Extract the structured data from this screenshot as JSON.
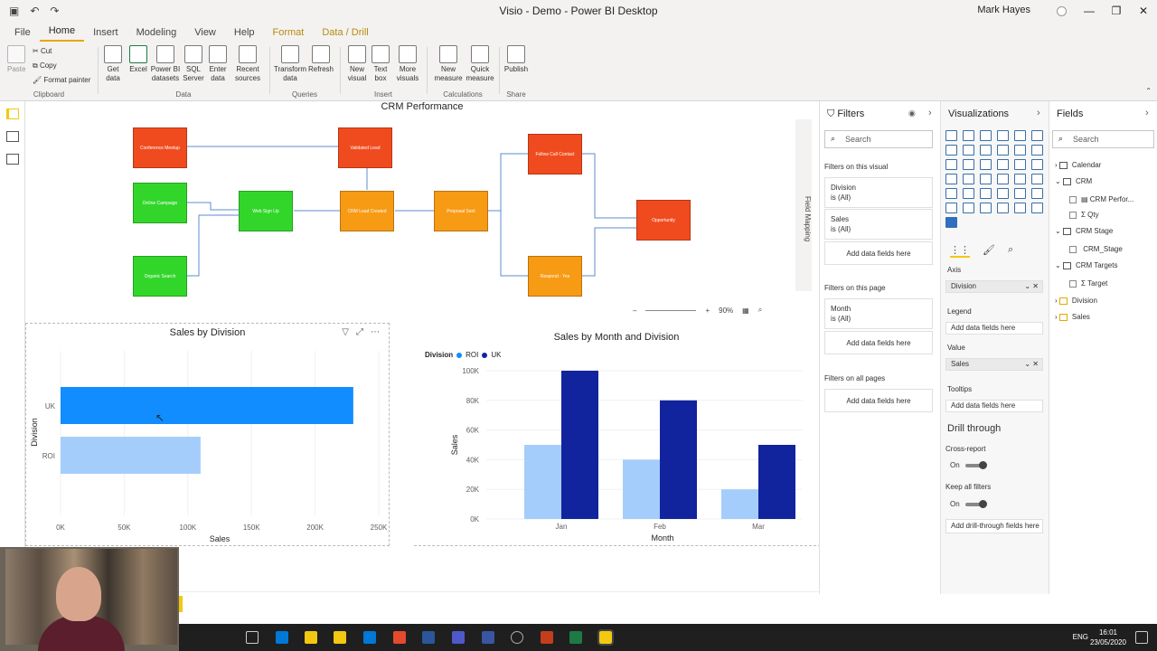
{
  "window": {
    "title": "Visio - Demo - Power BI Desktop",
    "user": "Mark Hayes",
    "minimize": "—",
    "restore": "❐",
    "close": "✕"
  },
  "menu": {
    "tabs": [
      "File",
      "Home",
      "Insert",
      "Modeling",
      "View",
      "Help",
      "Format",
      "Data / Drill"
    ]
  },
  "ribbon": {
    "clipboard": {
      "paste": "Paste",
      "cut": "Cut",
      "copy": "Copy",
      "format_painter": "Format painter",
      "label": "Clipboard"
    },
    "data": {
      "buttons": [
        "Get data",
        "Excel",
        "Power BI datasets",
        "SQL Server",
        "Enter data",
        "Recent sources"
      ],
      "label": "Data"
    },
    "queries": {
      "buttons": [
        "Transform data",
        "Refresh"
      ],
      "label": "Queries"
    },
    "insert": {
      "buttons": [
        "New visual",
        "Text box",
        "More visuals"
      ],
      "label": "Insert"
    },
    "calculations": {
      "buttons": [
        "New measure",
        "Quick measure"
      ],
      "label": "Calculations"
    },
    "share": {
      "buttons": [
        "Publish"
      ],
      "label": "Share"
    }
  },
  "visio": {
    "title": "CRM Performance",
    "shapes": [
      {
        "label": "Conference Meetup",
        "color": "red"
      },
      {
        "label": "Online Campaign",
        "color": "green"
      },
      {
        "label": "Organic Search",
        "color": "green"
      },
      {
        "label": "Web Sign Up",
        "color": "green"
      },
      {
        "label": "Validated Lead",
        "color": "red"
      },
      {
        "label": "CRM Lead Created",
        "color": "orange"
      },
      {
        "label": "Proposal Sent",
        "color": "orange"
      },
      {
        "label": "Follow Call Contact",
        "color": "red"
      },
      {
        "label": "Respond - Yes",
        "color": "orange"
      },
      {
        "label": "Opportunity",
        "color": "red"
      }
    ],
    "field_mapping": "Field Mapping",
    "zoom": "90%"
  },
  "chart_data": [
    {
      "type": "bar",
      "orientation": "horizontal",
      "title": "Sales by Division",
      "xlabel": "Sales",
      "ylabel": "Division",
      "categories": [
        "UK",
        "ROI"
      ],
      "values": [
        230000,
        110000
      ],
      "xlim": [
        0,
        250000
      ],
      "ticks": [
        "0K",
        "50K",
        "100K",
        "150K",
        "200K",
        "250K"
      ],
      "colors": [
        "#118dff",
        "#a4cdfc"
      ]
    },
    {
      "type": "bar",
      "title": "Sales by Month and Division",
      "xlabel": "Month",
      "ylabel": "Sales",
      "legend_title": "Division",
      "categories": [
        "Jan",
        "Feb",
        "Mar"
      ],
      "series": [
        {
          "name": "ROI",
          "values": [
            50000,
            40000,
            20000
          ],
          "color": "#a4cdfc"
        },
        {
          "name": "UK",
          "values": [
            100000,
            80000,
            50000
          ],
          "color": "#12239e"
        }
      ],
      "ylim": [
        0,
        100000
      ],
      "ticks": [
        "0K",
        "20K",
        "40K",
        "60K",
        "80K",
        "100K"
      ],
      "legend_markers": [
        "#118dff",
        "#12239e"
      ]
    }
  ],
  "filters": {
    "title": "Filters",
    "search": "Search",
    "on_visual": "Filters on this visual",
    "visual_cards": [
      {
        "name": "Division",
        "state": "is (All)"
      },
      {
        "name": "Sales",
        "state": "is (All)"
      }
    ],
    "add": "Add data fields here",
    "on_page": "Filters on this page",
    "page_cards": [
      {
        "name": "Month",
        "state": "is (All)"
      }
    ],
    "on_all": "Filters on all pages"
  },
  "visualizations": {
    "title": "Visualizations",
    "axis": "Axis",
    "axis_value": "Division",
    "legend": "Legend",
    "legend_value": "Add data fields here",
    "value": "Value",
    "value_value": "Sales",
    "tooltips": "Tooltips",
    "tooltips_value": "Add data fields here",
    "drill": "Drill through",
    "cross_report": "Cross-report",
    "keep_filters": "Keep all filters",
    "on": "On",
    "add_drill": "Add drill-through fields here"
  },
  "fields": {
    "title": "Fields",
    "search": "Search",
    "tree": [
      {
        "label": "Calendar",
        "kind": "table"
      },
      {
        "label": "CRM",
        "kind": "table"
      },
      {
        "label": "CRM Perfor...",
        "kind": "field"
      },
      {
        "label": "Σ Qty",
        "kind": "field"
      },
      {
        "label": "CRM Stage",
        "kind": "table"
      },
      {
        "label": "CRM_Stage",
        "kind": "field"
      },
      {
        "label": "CRM Targets",
        "kind": "table"
      },
      {
        "label": "Σ Target",
        "kind": "field"
      },
      {
        "label": "Division",
        "kind": "table"
      },
      {
        "label": "Sales",
        "kind": "table"
      }
    ]
  },
  "taskbar": {
    "lang": "ENG",
    "time": "16:01",
    "date": "23/05/2020"
  }
}
